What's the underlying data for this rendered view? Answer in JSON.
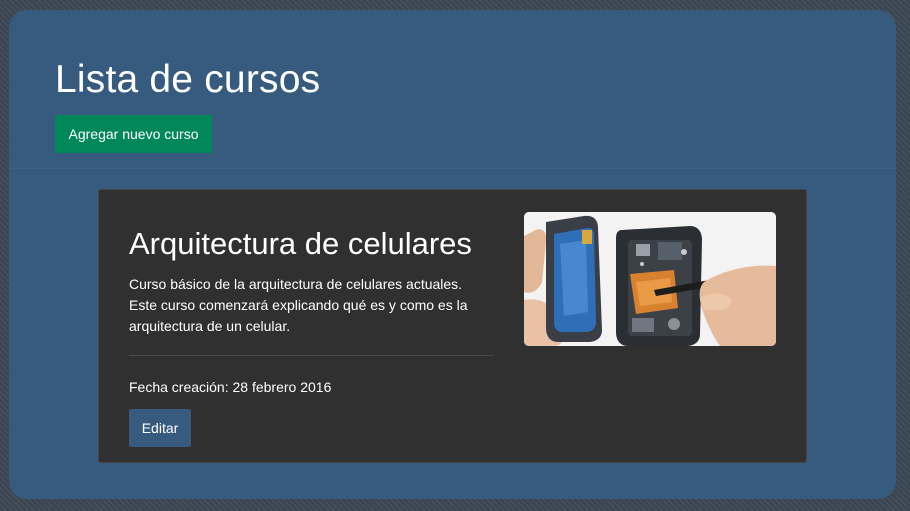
{
  "header": {
    "title": "Lista de cursos",
    "add_button_label": "Agregar nuevo curso"
  },
  "course": {
    "title": "Arquitectura de celulares",
    "description": "Curso básico de la arquitectura de celulares actuales. Este curso comenzará explicando qué es y como es la arquitectura de un celular.",
    "date_text": "Fecha creación: 28 febrero 2016",
    "edit_button_label": "Editar",
    "image_icon": "phone-repair-photo"
  },
  "colors": {
    "jumbotron_bg": "#375a7f",
    "card_bg": "#303030",
    "add_button_bg": "#00875a",
    "edit_button_bg": "#375a7f"
  }
}
